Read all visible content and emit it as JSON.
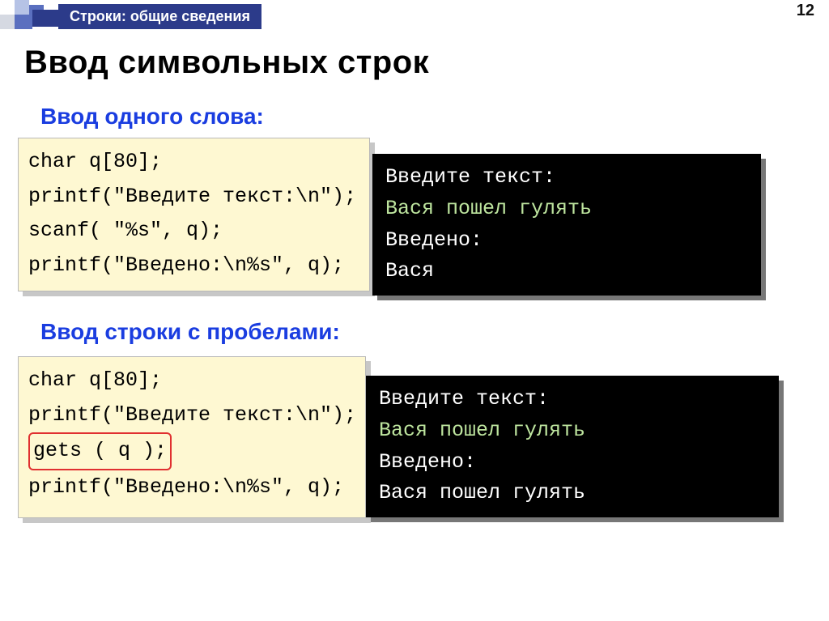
{
  "header": {
    "breadcrumb": "Строки: общие сведения",
    "page_number": "12"
  },
  "title": "Ввод символьных строк",
  "section1": {
    "heading": "Ввод одного слова:",
    "code": {
      "l1": "char q[80];",
      "l2": "printf(\"Введите текст:\\n\");",
      "l3": "scanf( \"%s\", q);",
      "l4": "printf(\"Введено:\\n%s\", q);"
    },
    "terminal": {
      "l1": "Введите текст:",
      "l2": "Вася пошел гулять",
      "l3": "Введено:",
      "l4": "Вася"
    }
  },
  "section2": {
    "heading": "Ввод строки с пробелами:",
    "code": {
      "l1": "char q[80];",
      "l2": "printf(\"Введите текст:\\n\");",
      "l3": "gets ( q );",
      "l4": "printf(\"Введено:\\n%s\", q);"
    },
    "terminal": {
      "l1": "Введите текст:",
      "l2": "Вася пошел гулять",
      "l3": "Введено:",
      "l4": "Вася пошел гулять"
    }
  }
}
